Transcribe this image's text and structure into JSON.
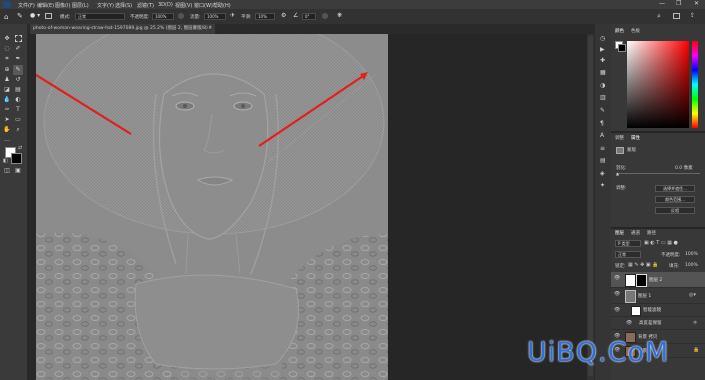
{
  "menubar": {
    "items": [
      "文件(F)",
      "编辑(E)",
      "图像(I)",
      "图层(L)",
      "文字(Y)",
      "选择(S)",
      "滤镜(T)",
      "3D(D)",
      "视图(V)",
      "窗口(W)",
      "帮助(H)"
    ],
    "window_controls": [
      "—",
      "❐",
      "✕"
    ]
  },
  "options_bar": {
    "mode_label": "模式:",
    "mode_value": "正常",
    "opacity_label": "不透明度:",
    "opacity_value": "100%",
    "flow_label": "流量:",
    "flow_value": "100%",
    "smoothing_label": "平滑:",
    "smoothing_value": "10%",
    "angle_value": "0°"
  },
  "document": {
    "tab_title": "photo-of-woman-wearing-straw-hat-1597089.jpg @ 25.2% (图层 2, 图层蒙版/8) *"
  },
  "color_panel": {
    "tabs": [
      "颜色",
      "色板"
    ],
    "accent_hue": "#ff0000"
  },
  "properties_panel": {
    "tabs": [
      "调整",
      "属性"
    ],
    "mask_label": "蒙版",
    "density_label": "浓度:",
    "feather_label": "羽化:",
    "feather_value": "0.0 像素",
    "refine_label": "调整:",
    "buttons": [
      "选择并遮住...",
      "颜色范围...",
      "反相"
    ]
  },
  "layers_panel": {
    "tabs": [
      "图层",
      "通道",
      "路径"
    ],
    "filter_kind": "P 类型",
    "blend_mode": "正常",
    "opacity_label": "不透明度:",
    "opacity_value": "100%",
    "lock_label": "锁定:",
    "fill_label": "填充:",
    "fill_value": "100%",
    "layers": [
      {
        "name": "图层 2"
      },
      {
        "name": "图层 1"
      },
      {
        "name": "智能滤镜"
      },
      {
        "name": "高反差保留"
      },
      {
        "name": "背景 拷贝"
      },
      {
        "name": "背景"
      }
    ]
  },
  "watermark": "UiBQ.CoM"
}
